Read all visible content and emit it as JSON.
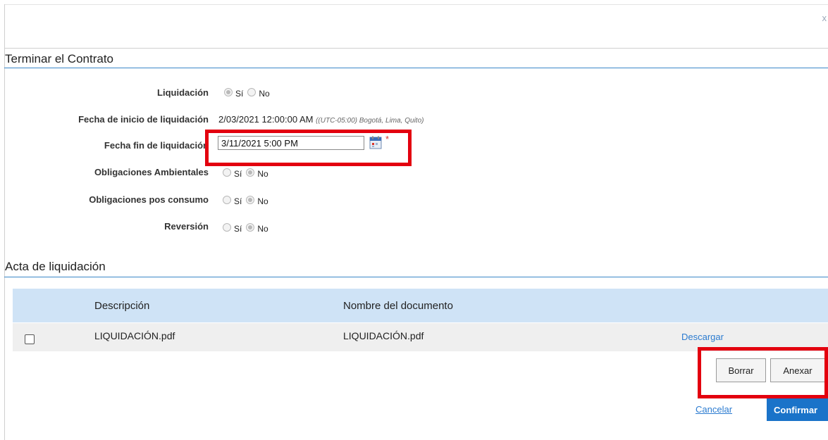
{
  "dialog": {
    "close_glyph": "x"
  },
  "section1": {
    "title": "Terminar el Contrato"
  },
  "fields": {
    "liquidacion": {
      "label": "Liquidación",
      "options": [
        "Sí",
        "No"
      ],
      "selected": "Sí"
    },
    "fecha_inicio": {
      "label": "Fecha de inicio de liquidación",
      "value": "2/03/2021 12:00:00 AM",
      "timezone": "((UTC-05:00) Bogotá, Lima, Quito)"
    },
    "fecha_fin": {
      "label": "Fecha fin de liquidación",
      "value": "3/11/2021 5:00 PM",
      "required_mark": "*"
    },
    "obligaciones_ambientales": {
      "label": "Obligaciones Ambientales",
      "options": [
        "Sí",
        "No"
      ],
      "selected": "No"
    },
    "obligaciones_pos_consumo": {
      "label": "Obligaciones pos consumo",
      "options": [
        "Sí",
        "No"
      ],
      "selected": "No"
    },
    "reversion": {
      "label": "Reversión",
      "options": [
        "Sí",
        "No"
      ],
      "selected": "No"
    }
  },
  "section2": {
    "title": "Acta de liquidación"
  },
  "table": {
    "headers": [
      "Descripción",
      "Nombre del documento"
    ],
    "rows": [
      {
        "descripcion": "LIQUIDACIÓN.pdf",
        "nombre": "LIQUIDACIÓN.pdf",
        "action": "Descargar",
        "checked": false
      }
    ]
  },
  "buttons": {
    "borrar": "Borrar",
    "anexar": "Anexar",
    "cancelar": "Cancelar",
    "confirmar": "Confirmar"
  },
  "colors": {
    "highlight": "#e3000f",
    "accent": "#1a73c9",
    "header_bg": "#cfe3f6",
    "link": "#2b7bd0"
  },
  "icons": {
    "calendar": "calendar-icon"
  }
}
